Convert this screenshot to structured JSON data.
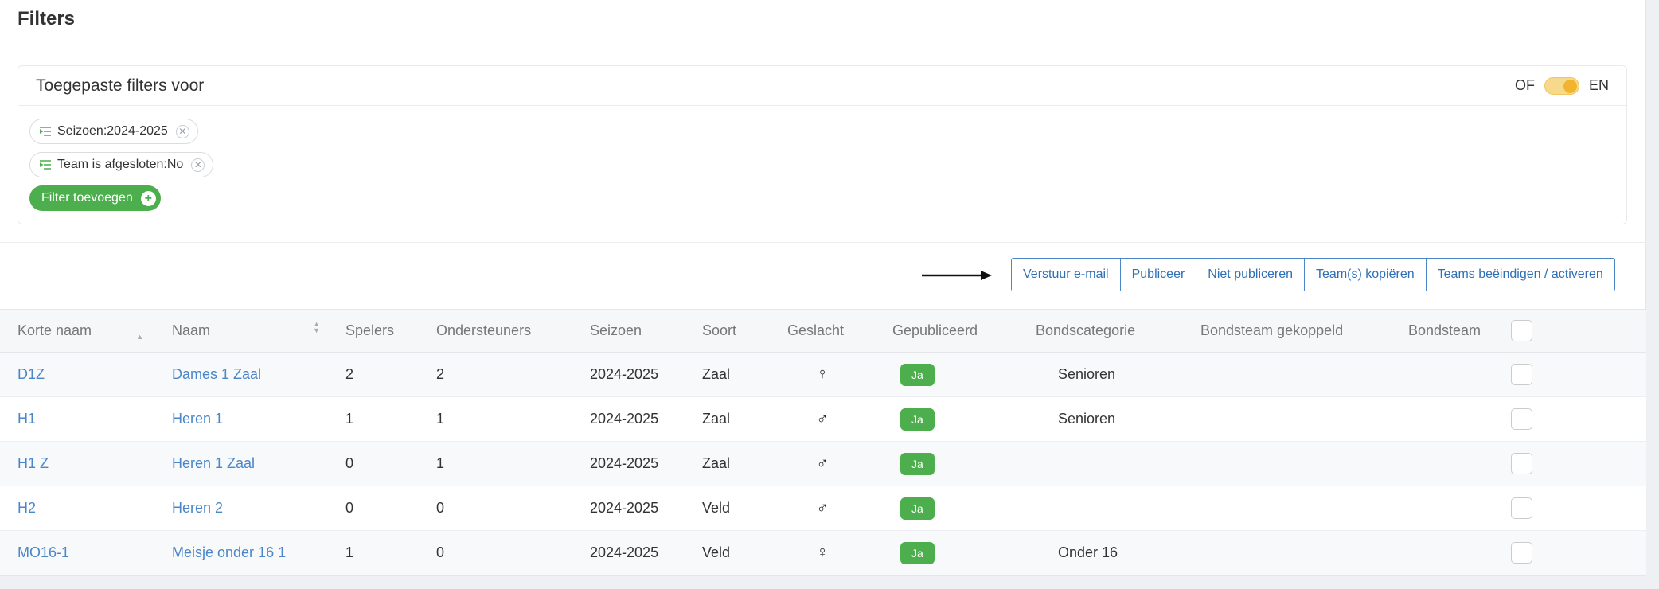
{
  "page": {
    "title": "Filters"
  },
  "filters_card": {
    "title": "Toegepaste filters voor",
    "toggle_left": "OF",
    "toggle_right": "EN",
    "chips": [
      {
        "label": "Seizoen:2024-2025",
        "icon": "filter-list-icon"
      },
      {
        "label": "Team is afgesloten:No",
        "icon": "filter-list-icon"
      }
    ],
    "add_filter_label": "Filter toevoegen"
  },
  "actions": {
    "buttons": [
      "Verstuur e-mail",
      "Publiceer",
      "Niet publiceren",
      "Team(s) kopiëren",
      "Teams beëindigen / activeren"
    ]
  },
  "table": {
    "columns": [
      "Korte naam",
      "Naam",
      "Spelers",
      "Ondersteuners",
      "Seizoen",
      "Soort",
      "Geslacht",
      "Gepubliceerd",
      "Bondscategorie",
      "Bondsteam gekoppeld",
      "Bondsteam"
    ],
    "rows": [
      {
        "short": "D1Z",
        "name": "Dames 1 Zaal",
        "players": "2",
        "supporters": "2",
        "season": "2024-2025",
        "type": "Zaal",
        "gender": "♀",
        "published": "Ja",
        "category": "Senioren",
        "linked": "",
        "team": ""
      },
      {
        "short": "H1",
        "name": "Heren 1",
        "players": "1",
        "supporters": "1",
        "season": "2024-2025",
        "type": "Zaal",
        "gender": "♂",
        "published": "Ja",
        "category": "Senioren",
        "linked": "",
        "team": ""
      },
      {
        "short": "H1 Z",
        "name": "Heren 1 Zaal",
        "players": "0",
        "supporters": "1",
        "season": "2024-2025",
        "type": "Zaal",
        "gender": "♂",
        "published": "Ja",
        "category": "",
        "linked": "",
        "team": ""
      },
      {
        "short": "H2",
        "name": "Heren 2",
        "players": "0",
        "supporters": "0",
        "season": "2024-2025",
        "type": "Veld",
        "gender": "♂",
        "published": "Ja",
        "category": "",
        "linked": "",
        "team": ""
      },
      {
        "short": "MO16-1",
        "name": "Meisje onder 16 1",
        "players": "1",
        "supporters": "0",
        "season": "2024-2025",
        "type": "Veld",
        "gender": "♀",
        "published": "Ja",
        "category": "Onder 16",
        "linked": "",
        "team": ""
      }
    ]
  },
  "colors": {
    "accent_green": "#4cae4c",
    "link_blue": "#4a86c8",
    "toggle_yellow": "#f2b42c"
  }
}
